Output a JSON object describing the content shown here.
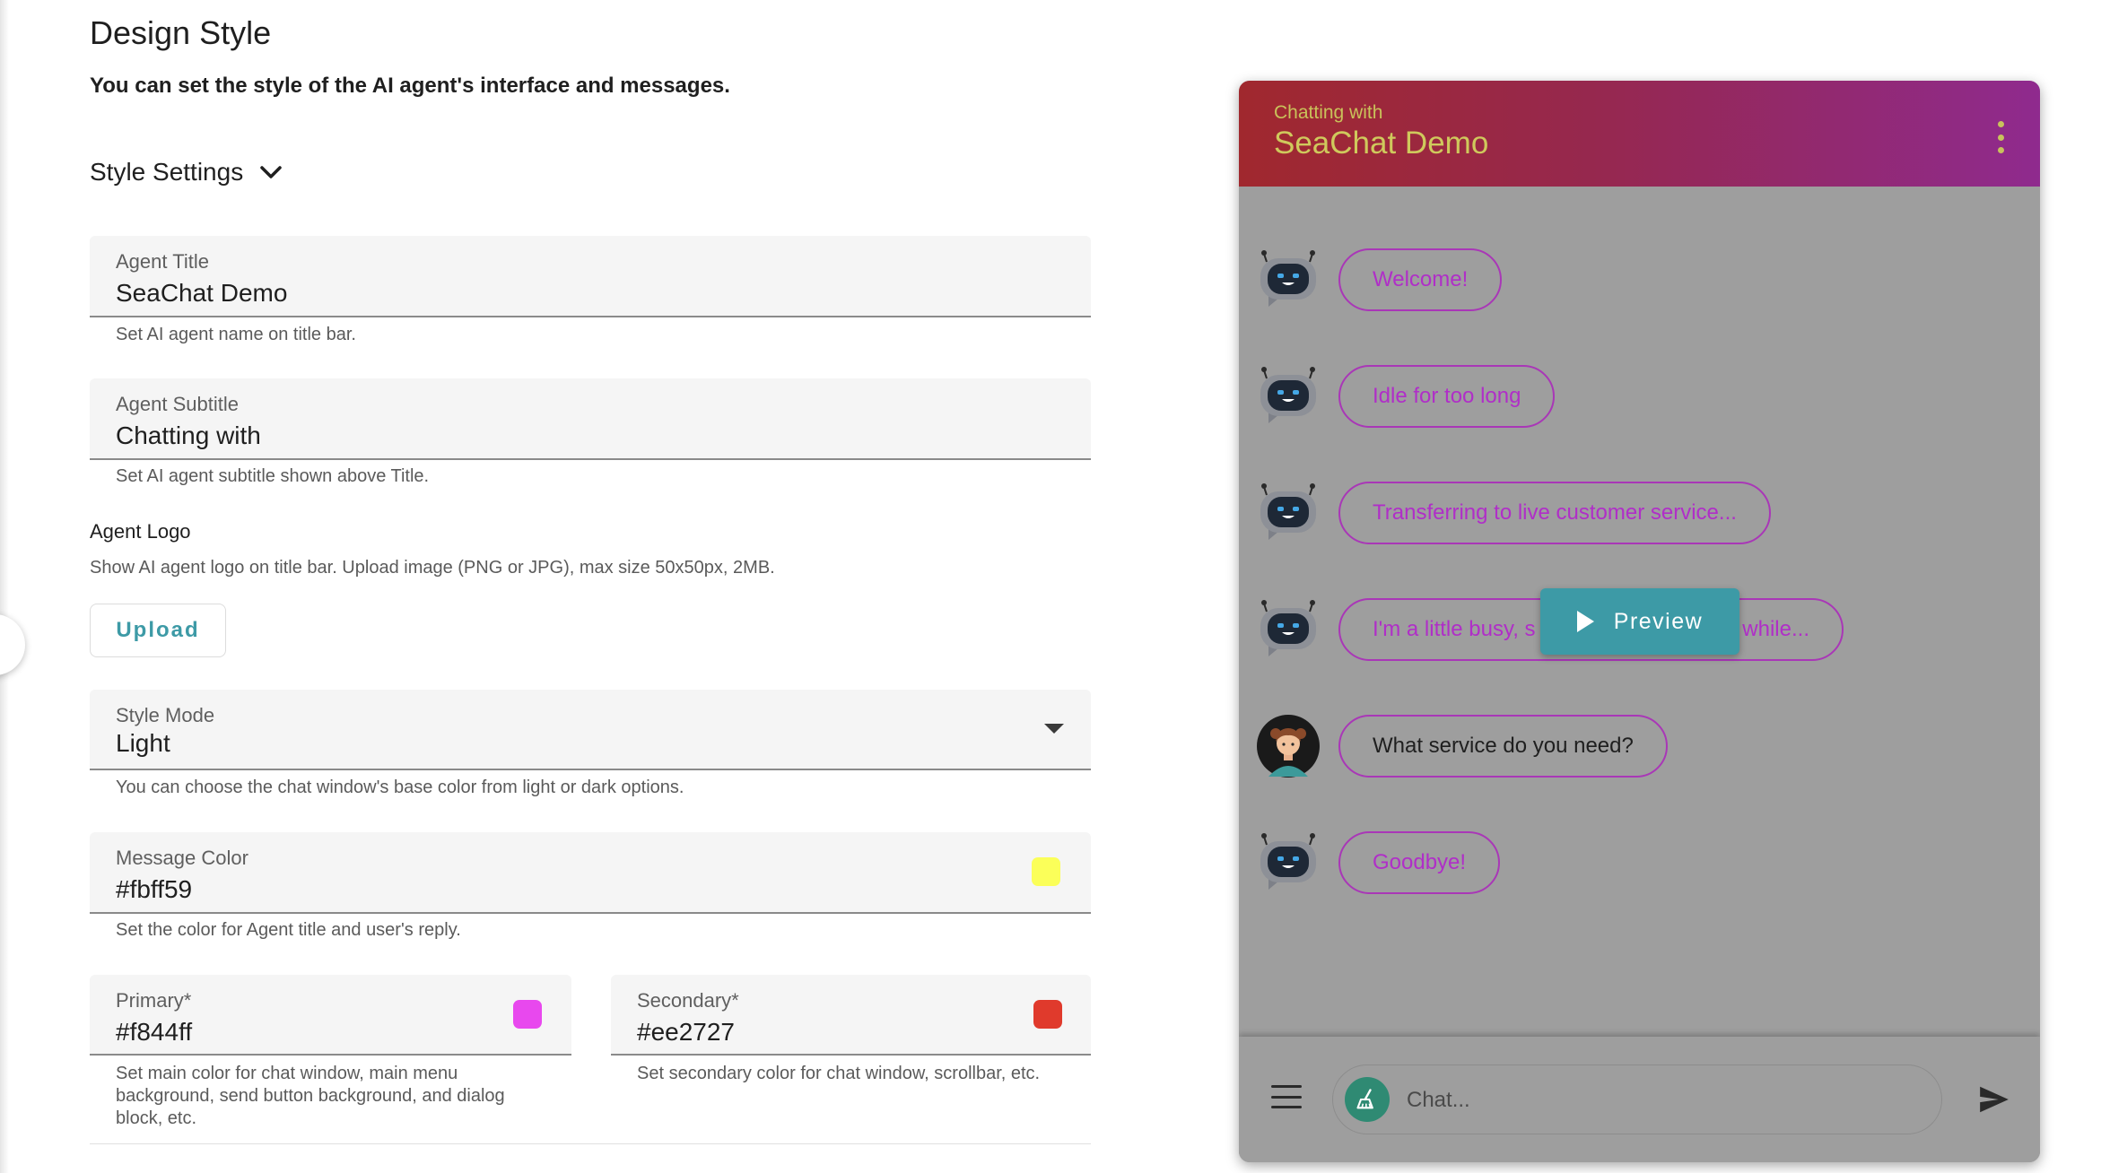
{
  "page": {
    "heading": "Design Style",
    "subheading": "You can set the style of the AI agent's interface and messages."
  },
  "style_settings": {
    "toggle_label": "Style Settings",
    "agent_title": {
      "label": "Agent Title",
      "value": "SeaChat Demo",
      "hint": "Set AI agent name on title bar."
    },
    "agent_subtitle": {
      "label": "Agent Subtitle",
      "value": "Chatting with",
      "hint": "Set AI agent subtitle shown above Title."
    },
    "agent_logo": {
      "label": "Agent Logo",
      "hint": "Show AI agent logo on title bar. Upload image (PNG or JPG), max size 50x50px, 2MB.",
      "upload_label": "Upload"
    },
    "style_mode": {
      "label": "Style Mode",
      "value": "Light",
      "hint": "You can choose the chat window's base color from light or dark options."
    },
    "message_color": {
      "label": "Message Color",
      "value": "#fbff59",
      "hint": "Set the color for Agent title and user's reply."
    },
    "primary": {
      "label": "Primary*",
      "value": "#f844ff",
      "hint": "Set main color for chat window, main menu background, send button background, and dialog block, etc."
    },
    "secondary": {
      "label": "Secondary*",
      "value": "#ee2727",
      "hint": "Set secondary color for chat window, scrollbar, etc."
    }
  },
  "colors": {
    "message_swatch": "#fbff59",
    "primary_swatch": "#e848ee",
    "secondary_swatch": "#e03a2c",
    "accent_teal": "#3d9aa6"
  },
  "chat_preview": {
    "subtitle": "Chatting with",
    "title": "SeaChat Demo",
    "messages": [
      {
        "sender": "agent",
        "text": "Welcome!"
      },
      {
        "sender": "agent",
        "text": "Idle for too long"
      },
      {
        "sender": "agent",
        "text": "Transferring to live customer service..."
      },
      {
        "sender": "agent",
        "text": "I'm a little busy, s",
        "text_tail": "while..."
      },
      {
        "sender": "user",
        "text": "What service do you need?"
      },
      {
        "sender": "agent",
        "text": "Goodbye!"
      }
    ],
    "preview_button": "Preview",
    "input_placeholder": "Chat..."
  }
}
